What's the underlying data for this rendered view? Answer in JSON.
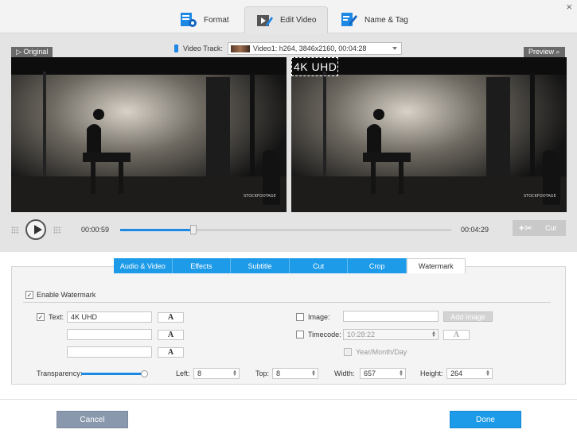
{
  "window": {
    "close_glyph": "×"
  },
  "top_tabs": [
    {
      "label": "Format",
      "icon": "format-settings-icon"
    },
    {
      "label": "Edit Video",
      "icon": "edit-video-icon"
    },
    {
      "label": "Name & Tag",
      "icon": "name-tag-icon"
    }
  ],
  "video_track": {
    "label": "Video Track:",
    "value": "Video1: h264, 3846x2160, 00:04:28"
  },
  "preview": {
    "original_label": "Original",
    "preview_label": "Preview",
    "watermark_overlay": "4K UHD",
    "logo_text": "STOCKFOOTAGE"
  },
  "playback": {
    "current_time": "00:00:59",
    "total_time": "00:04:29",
    "progress_fraction": 0.22,
    "cut_label": "Cut"
  },
  "edit_tabs": [
    {
      "label": "Audio & Video",
      "active": false
    },
    {
      "label": "Effects",
      "active": false
    },
    {
      "label": "Subtitle",
      "active": false
    },
    {
      "label": "Cut",
      "active": false
    },
    {
      "label": "Crop",
      "active": false
    },
    {
      "label": "Watermark",
      "active": true
    }
  ],
  "watermark": {
    "enable_label": "Enable Watermark",
    "text_label": "Text:",
    "text_value": "4K UHD",
    "font_glyph": "A",
    "image_label": "Image:",
    "add_image_label": "Add Image",
    "timecode_label": "Timecode:",
    "timecode_value": "10:28:22",
    "date_label": "Year/Month/Day",
    "transparency_label": "Transparency:",
    "transparency_fraction": 1.0,
    "left_label": "Left:",
    "left_value": "8",
    "top_label": "Top:",
    "top_value": "8",
    "width_label": "Width:",
    "width_value": "657",
    "height_label": "Height:",
    "height_value": "264"
  },
  "buttons": {
    "cancel": "Cancel",
    "done": "Done"
  },
  "colors": {
    "accent": "#1e9be8",
    "cancel": "#8a98ad"
  }
}
